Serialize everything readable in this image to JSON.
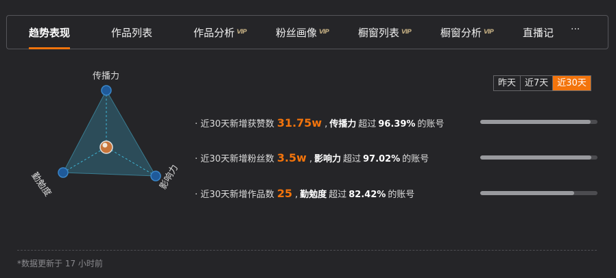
{
  "tabs": [
    {
      "label": "趋势表现",
      "vip": false,
      "active": true
    },
    {
      "label": "作品列表",
      "vip": false,
      "active": false
    },
    {
      "label": "作品分析",
      "vip": true,
      "active": false
    },
    {
      "label": "粉丝画像",
      "vip": true,
      "active": false
    },
    {
      "label": "橱窗列表",
      "vip": true,
      "active": false
    },
    {
      "label": "橱窗分析",
      "vip": true,
      "active": false
    },
    {
      "label": "直播记",
      "vip": false,
      "active": false
    }
  ],
  "vip_mark": "VIP",
  "more_label": "···",
  "radar": {
    "top_label": "传播力",
    "left_label": "勤勉度",
    "right_label": "影响力"
  },
  "periods": [
    {
      "label": "昨天",
      "active": false
    },
    {
      "label": "近7天",
      "active": false
    },
    {
      "label": "近30天",
      "active": true
    }
  ],
  "stats": [
    {
      "prefix": "· 近30天新增获赞数",
      "value": "31.75w",
      "sep": ",",
      "dimension": "传播力",
      "exceed": "超过",
      "percent": "96.39%",
      "suffix": "的账号",
      "bar_fraction": 0.94
    },
    {
      "prefix": "· 近30天新增粉丝数",
      "value": "3.5w",
      "sep": ",",
      "dimension": "影响力",
      "exceed": "超过",
      "percent": "97.02%",
      "suffix": "的账号",
      "bar_fraction": 0.95
    },
    {
      "prefix": "· 近30天新增作品数",
      "value": "25",
      "sep": ",",
      "dimension": "勤勉度",
      "exceed": "超过",
      "percent": "82.42%",
      "suffix": "的账号",
      "bar_fraction": 0.8
    }
  ],
  "footnote": "*数据更新于 17 小时前",
  "colors": {
    "accent": "#f3740c",
    "background": "#252528",
    "triangle_fill": "#2f5a6a",
    "node": "#1f5a9a"
  }
}
